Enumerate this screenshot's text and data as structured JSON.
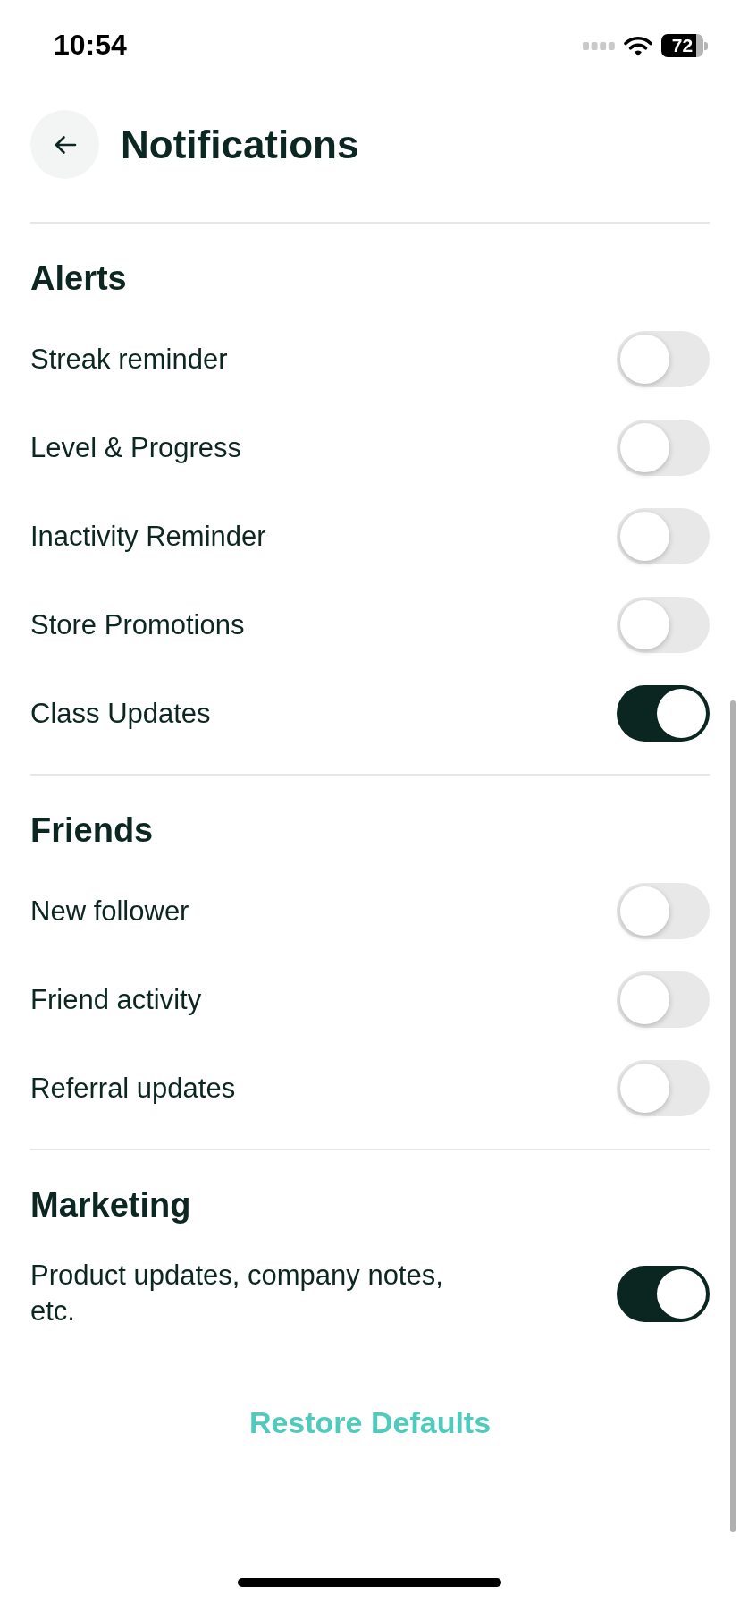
{
  "status_bar": {
    "time": "10:54",
    "battery": "72"
  },
  "header": {
    "title": "Notifications"
  },
  "sections": [
    {
      "title": "Alerts",
      "items": [
        {
          "label": "Streak reminder",
          "on": false
        },
        {
          "label": "Level & Progress",
          "on": false
        },
        {
          "label": "Inactivity Reminder",
          "on": false
        },
        {
          "label": "Store Promotions",
          "on": false
        },
        {
          "label": "Class Updates",
          "on": true
        }
      ]
    },
    {
      "title": "Friends",
      "items": [
        {
          "label": "New follower",
          "on": false
        },
        {
          "label": "Friend activity",
          "on": false
        },
        {
          "label": "Referral updates",
          "on": false
        }
      ]
    },
    {
      "title": "Marketing",
      "items": [
        {
          "label": "Product updates, company notes, etc.",
          "on": true
        }
      ]
    }
  ],
  "restore_button": {
    "label": "Restore Defaults"
  }
}
